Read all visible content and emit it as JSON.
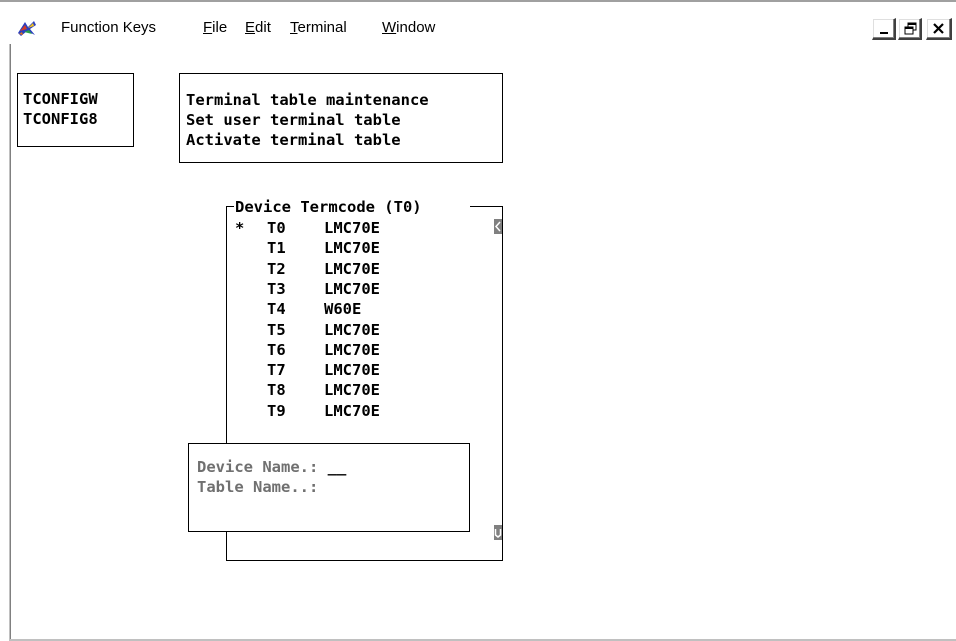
{
  "menubar": {
    "items": [
      {
        "label": "Function Keys",
        "accel": ""
      },
      {
        "label": "File",
        "accel": "F"
      },
      {
        "label": "Edit",
        "accel": "E"
      },
      {
        "label": "Terminal",
        "accel": "T"
      },
      {
        "label": "Window",
        "accel": "W"
      }
    ]
  },
  "terminal": {
    "commands": [
      "TCONFIGW",
      "TCONFIG8"
    ],
    "descriptions": [
      "Terminal table maintenance",
      "Set user terminal table",
      "Activate terminal table"
    ],
    "device_list": {
      "title": "Device Termcode (T0)",
      "rows": [
        {
          "marker": "*",
          "device": "T0",
          "termcode": "LMC70E"
        },
        {
          "marker": "",
          "device": "T1",
          "termcode": "LMC70E"
        },
        {
          "marker": "",
          "device": "T2",
          "termcode": "LMC70E"
        },
        {
          "marker": "",
          "device": "T3",
          "termcode": "LMC70E"
        },
        {
          "marker": "",
          "device": "T4",
          "termcode": "W60E"
        },
        {
          "marker": "",
          "device": "T5",
          "termcode": "LMC70E"
        },
        {
          "marker": "",
          "device": "T6",
          "termcode": "LMC70E"
        },
        {
          "marker": "",
          "device": "T7",
          "termcode": "LMC70E"
        },
        {
          "marker": "",
          "device": "T8",
          "termcode": "LMC70E"
        },
        {
          "marker": "",
          "device": "T9",
          "termcode": "LMC70E"
        }
      ],
      "scroll_up_glyph": "<",
      "scroll_down_glyph": "v"
    },
    "entry": {
      "device_name_label": "Device Name.:",
      "device_name_value": "__",
      "table_name_label": "Table Name..:",
      "table_name_value": ""
    }
  },
  "icons": {
    "app": "application-icon",
    "minimize": "minimize-icon",
    "restore": "restore-icon",
    "close": "close-icon"
  }
}
